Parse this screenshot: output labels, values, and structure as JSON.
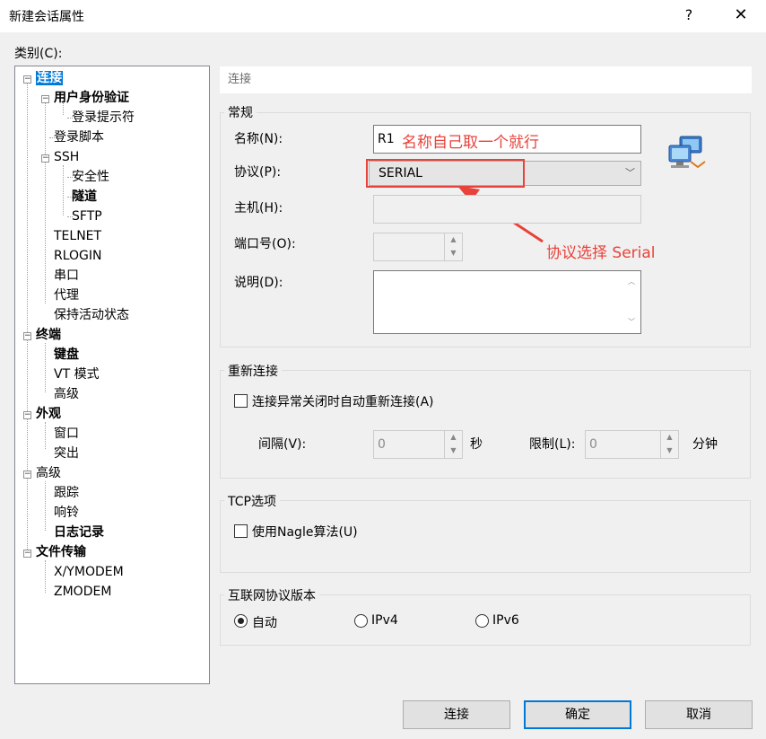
{
  "window": {
    "title": "新建会话属性",
    "help": "?",
    "close": "✕"
  },
  "category_label": "类别(C):",
  "tree": [
    {
      "label": "连接"
    },
    {
      "label": "用户身份验证"
    },
    {
      "label": "登录提示符"
    },
    {
      "label": "登录脚本"
    },
    {
      "label": "SSH"
    },
    {
      "label": "安全性"
    },
    {
      "label": "隧道"
    },
    {
      "label": "SFTP"
    },
    {
      "label": "TELNET"
    },
    {
      "label": "RLOGIN"
    },
    {
      "label": "串口"
    },
    {
      "label": "代理"
    },
    {
      "label": "保持活动状态"
    },
    {
      "label": "终端"
    },
    {
      "label": "键盘"
    },
    {
      "label": "VT 模式"
    },
    {
      "label": "高级"
    },
    {
      "label": "外观"
    },
    {
      "label": "窗口"
    },
    {
      "label": "突出"
    },
    {
      "label": "高级"
    },
    {
      "label": "跟踪"
    },
    {
      "label": "响铃"
    },
    {
      "label": "日志记录"
    },
    {
      "label": "文件传输"
    },
    {
      "label": "X/YMODEM"
    },
    {
      "label": "ZMODEM"
    }
  ],
  "section_header": "连接",
  "general": {
    "title": "常规",
    "name_label": "名称(N):",
    "name_value": "R1",
    "protocol_label": "协议(P):",
    "protocol_value": "SERIAL",
    "host_label": "主机(H):",
    "host_value": "",
    "port_label": "端口号(O):",
    "port_value": "",
    "desc_label": "说明(D):",
    "desc_value": ""
  },
  "reconnect": {
    "title": "重新连接",
    "checkbox_label": "连接异常关闭时自动重新连接(A)",
    "checked": false,
    "interval_label": "间隔(V):",
    "interval_value": "0",
    "interval_unit": "秒",
    "limit_label": "限制(L):",
    "limit_value": "0",
    "limit_unit": "分钟"
  },
  "tcp": {
    "title": "TCP选项",
    "nagle_label": "使用Nagle算法(U)",
    "checked": false
  },
  "ip": {
    "title": "互联网协议版本",
    "options": [
      "自动",
      "IPv4",
      "IPv6"
    ],
    "selected": "自动"
  },
  "buttons": {
    "connect": "连接",
    "ok": "确定",
    "cancel": "取消"
  },
  "annotations": {
    "name_note": "名称自己取一个就行",
    "protocol_note": "协议选择 Serial",
    "color": "#e8423a"
  }
}
